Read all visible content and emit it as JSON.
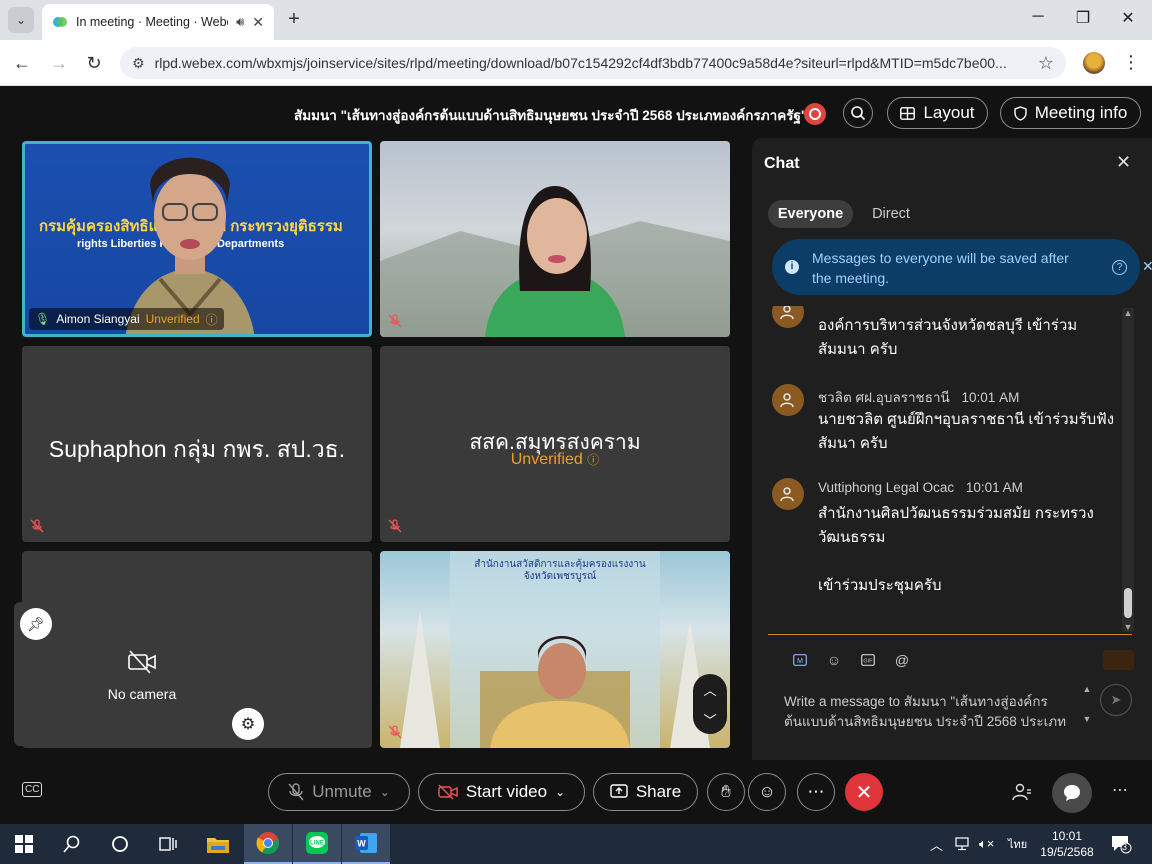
{
  "browser": {
    "tab_title": "In meeting · Meeting · Webex",
    "url": "rlpd.webex.com/wbxmjs/joinservice/sites/rlpd/meeting/download/b07c154292cf4df3bdb77400c9a58d4e?siteurl=rlpd&MTID=m5dc7be00..."
  },
  "header": {
    "meeting_title": "สัมมนา \"เส้นทางสู่องค์กรต้นแบบด้านสิทธิมนุษยชน ประจำปี 2568 ประเภทองค์กรภาครัฐ\"",
    "layout_label": "Layout",
    "meeting_info_label": "Meeting info"
  },
  "tiles": {
    "t1_banner_line1": "กรมคุ้มครองสิทธิและเสรีภาพ กระทรวงยุติธรรม",
    "t1_banner_line2": "rights Liberties Protection Departments",
    "t1_name": "Aimon Siangyai",
    "t1_unverified": "Unverified",
    "t3_name": "Suphaphon กลุ่ม กพร. สป.วธ.",
    "t4_name": "สสค.สมุทรสงคราม",
    "t4_unverified": "Unverified",
    "t6_banner": "สำนักงานสวัสดิการและคุ้มครองแรงงาน จังหวัดเพชรบูรณ์"
  },
  "self_view": {
    "no_camera": "No camera"
  },
  "chat": {
    "title": "Chat",
    "tab_everyone": "Everyone",
    "tab_direct": "Direct",
    "notice": "Messages to everyone will be saved after the meeting.",
    "messages": [
      {
        "sender": "",
        "time": "",
        "body": "องค์การบริหารส่วนจังหวัดชลบุรี เข้าร่วมสัมมนา ครับ"
      },
      {
        "sender": "ชวลิต ศฝ.อุบลราชธานี",
        "time": "10:01 AM",
        "body": "นายชวลิต  ศูนย์ฝึกฯอุบลราชธานี  เข้าร่วมรับฟังสัมนา ครับ"
      },
      {
        "sender": "Vuttiphong Legal Ocac",
        "time": "10:01 AM",
        "body": "สำนักงานศิลปวัฒนธรรมร่วมสมัย กระทรวงวัฒนธรรม",
        "body2": "เข้าร่วมประชุมครับ"
      }
    ],
    "compose_placeholder": "Write a message to สัมมนา \"เส้นทางสู่องค์กรต้นแบบด้านสิทธิมนุษยชน ประจำปี 2568 ประเภท"
  },
  "controls": {
    "unmute": "Unmute",
    "start_video": "Start video",
    "share": "Share"
  },
  "taskbar": {
    "lang": "ไทย",
    "time": "10:01",
    "date": "19/5/2568",
    "notif_count": "3"
  },
  "colors": {
    "accent_teal": "#3fb6c8",
    "unverified": "#f0a020",
    "end_call": "#e0353b",
    "notice_bg": "#0b3d66"
  }
}
